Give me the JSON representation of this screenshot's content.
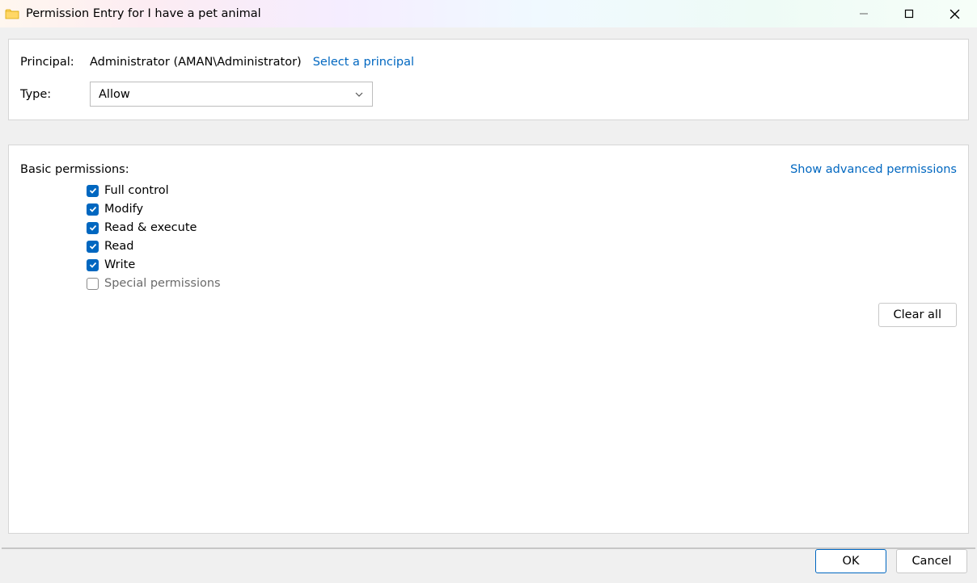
{
  "window": {
    "title": "Permission Entry for I have a pet animal"
  },
  "top": {
    "principal_label": "Principal:",
    "principal_value": "Administrator (AMAN\\Administrator)",
    "select_principal_link": "Select a principal",
    "type_label": "Type:",
    "type_value": "Allow"
  },
  "permissions": {
    "header": "Basic permissions:",
    "advanced_link": "Show advanced permissions",
    "items": [
      {
        "label": "Full control",
        "checked": true,
        "enabled": true
      },
      {
        "label": "Modify",
        "checked": true,
        "enabled": true
      },
      {
        "label": "Read & execute",
        "checked": true,
        "enabled": true
      },
      {
        "label": "Read",
        "checked": true,
        "enabled": true
      },
      {
        "label": "Write",
        "checked": true,
        "enabled": true
      },
      {
        "label": "Special permissions",
        "checked": false,
        "enabled": false
      }
    ],
    "clear_all": "Clear all"
  },
  "footer": {
    "ok": "OK",
    "cancel": "Cancel"
  }
}
